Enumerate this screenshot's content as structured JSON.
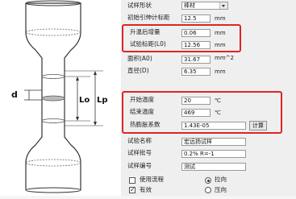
{
  "form": {
    "shape_label": "试样形状",
    "shape_value": "棒材",
    "initial_gauge_label": "初始引伸计标距",
    "initial_gauge_value": "12.5",
    "initial_gauge_unit": "mm",
    "gain_label": "升温后增量",
    "gain_value": "0.06",
    "gain_unit": "mm",
    "gauge_length_label": "试验标距(L0)",
    "gauge_length_value": "12.56",
    "gauge_length_unit": "mm",
    "area_label": "面积(A0)",
    "area_value": "31.67",
    "area_unit": "mm^2",
    "diameter_label": "直径(D)",
    "diameter_value": "6.35",
    "diameter_unit": "mm",
    "start_temp_label": "开始温度",
    "start_temp_value": "20",
    "start_temp_unit": "℃",
    "end_temp_label": "结束温度",
    "end_temp_value": "469",
    "end_temp_unit": "℃",
    "expansion_label": "热膨胀系数",
    "expansion_value": "1.43E-05",
    "calc_button": "计算",
    "test_name_label": "试验名称",
    "test_name_value": "宏远扬试样",
    "batch_label": "试样批号",
    "batch_value": "0.2% R=-1",
    "sample_no_label": "试样编号",
    "sample_no_value": "测试",
    "use_flow_label": "使用流程",
    "valid_label": "有效",
    "tension_label": "拉向",
    "compression_label": "压向"
  },
  "diagram": {
    "d_label": "d",
    "lo_label": "Lo",
    "lp_label": "Lp"
  },
  "colors": {
    "highlight": "#e02424"
  }
}
